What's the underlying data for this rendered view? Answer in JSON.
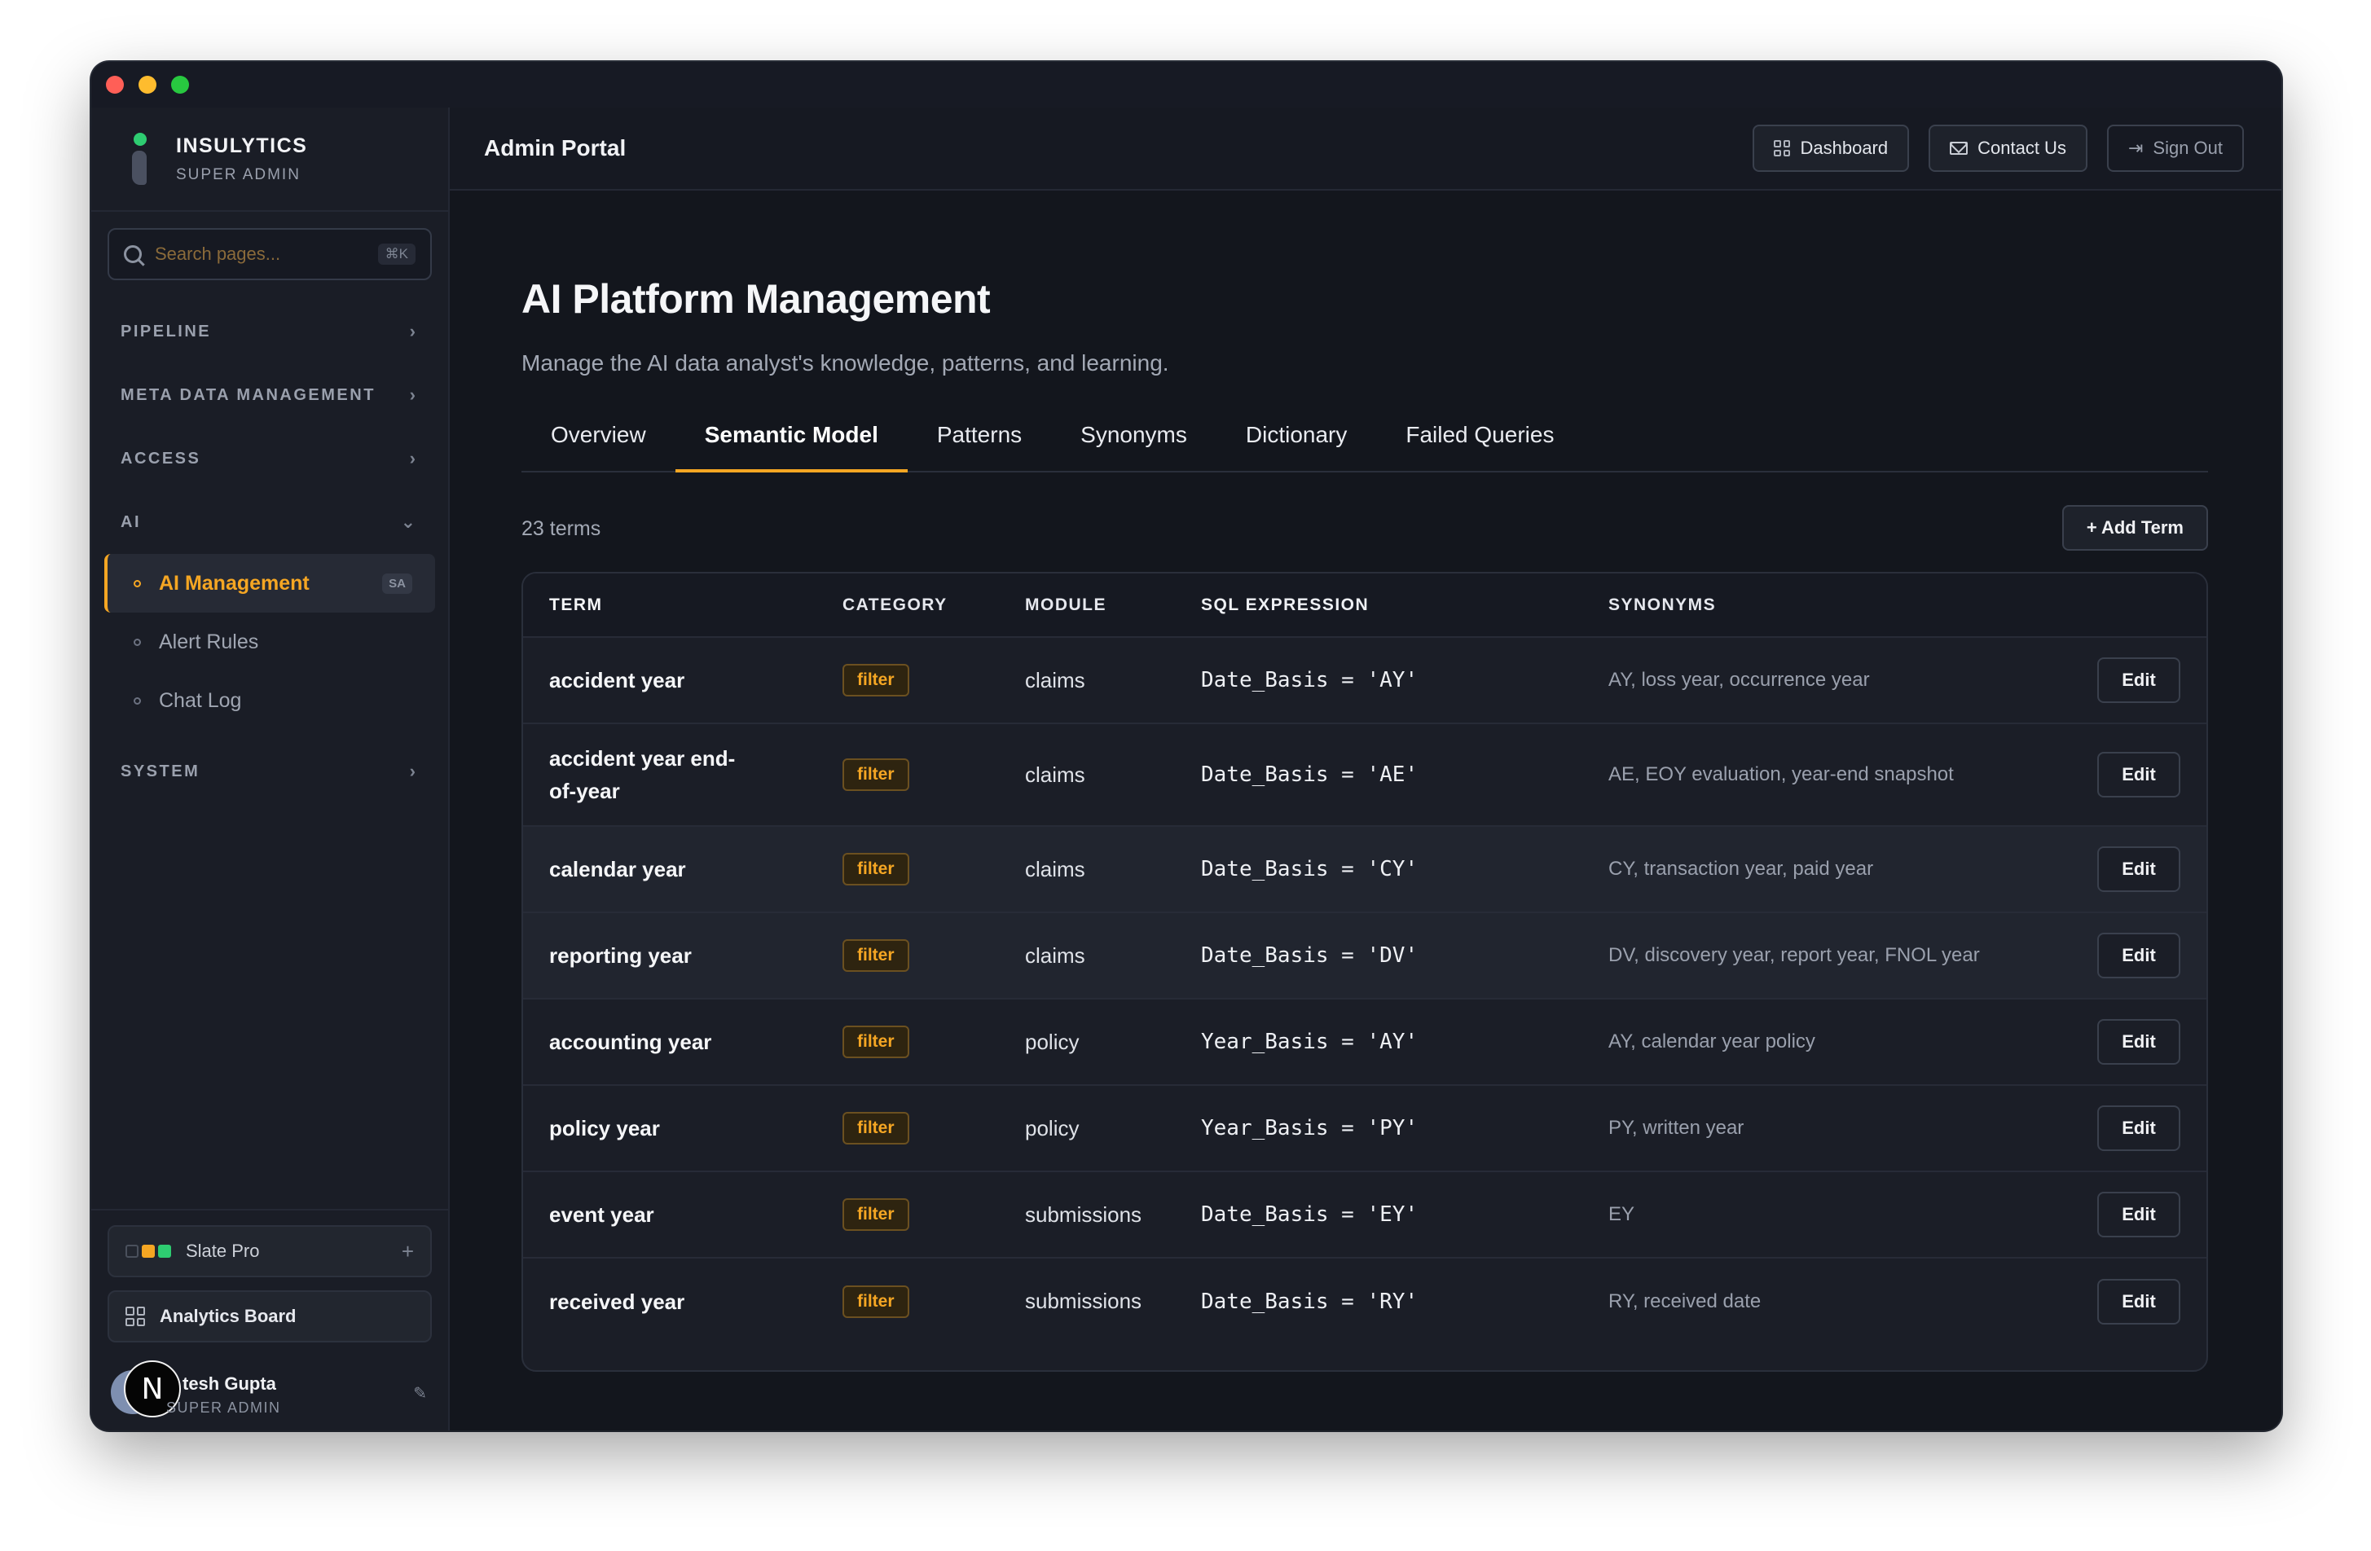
{
  "brand": {
    "name": "INSULYTICS",
    "role": "SUPER ADMIN"
  },
  "search": {
    "placeholder": "Search pages...",
    "shortcut": "⌘K"
  },
  "sidebar": {
    "sections": [
      {
        "label": "PIPELINE"
      },
      {
        "label": "META DATA MANAGEMENT"
      },
      {
        "label": "ACCESS"
      },
      {
        "label": "AI"
      },
      {
        "label": "SYSTEM"
      }
    ],
    "ai_items": [
      {
        "label": "AI Management",
        "badge": "SA"
      },
      {
        "label": "Alert Rules"
      },
      {
        "label": "Chat Log"
      }
    ],
    "workspace": "Slate Pro",
    "board": "Analytics Board"
  },
  "user": {
    "name": "tesh Gupta",
    "role": "SUPER ADMIN",
    "avatar_letter": "N"
  },
  "topbar": {
    "title": "Admin Portal",
    "dashboard": "Dashboard",
    "contact": "Contact Us",
    "signout": "Sign Out"
  },
  "page": {
    "title": "AI Platform Management",
    "subtitle": "Manage the AI data analyst's knowledge, patterns, and learning.",
    "tabs": [
      "Overview",
      "Semantic Model",
      "Patterns",
      "Synonyms",
      "Dictionary",
      "Failed Queries"
    ],
    "count": "23 terms",
    "add_label": "+ Add Term"
  },
  "table": {
    "headers": [
      "TERM",
      "CATEGORY",
      "MODULE",
      "SQL EXPRESSION",
      "SYNONYMS"
    ],
    "edit_label": "Edit",
    "rows": [
      {
        "term": "accident year",
        "category": "filter",
        "module": "claims",
        "sql": "Date_Basis = 'AY'",
        "synonyms": "AY, loss year, occurrence year"
      },
      {
        "term": "accident year end-of-year",
        "category": "filter",
        "module": "claims",
        "sql": "Date_Basis = 'AE'",
        "synonyms": "AE, EOY evaluation, year-end snapshot"
      },
      {
        "term": "calendar year",
        "category": "filter",
        "module": "claims",
        "sql": "Date_Basis = 'CY'",
        "synonyms": "CY, transaction year, paid year"
      },
      {
        "term": "reporting year",
        "category": "filter",
        "module": "claims",
        "sql": "Date_Basis = 'DV'",
        "synonyms": "DV, discovery year, report year, FNOL year"
      },
      {
        "term": "accounting year",
        "category": "filter",
        "module": "policy",
        "sql": "Year_Basis = 'AY'",
        "synonyms": "AY, calendar year policy"
      },
      {
        "term": "policy year",
        "category": "filter",
        "module": "policy",
        "sql": "Year_Basis = 'PY'",
        "synonyms": "PY, written year"
      },
      {
        "term": "event year",
        "category": "filter",
        "module": "submissions",
        "sql": "Date_Basis = 'EY'",
        "synonyms": "EY"
      },
      {
        "term": "received year",
        "category": "filter",
        "module": "submissions",
        "sql": "Date_Basis = 'RY'",
        "synonyms": "RY, received date"
      }
    ]
  },
  "colors": {
    "accent": "#f5a623",
    "bg": "#13161d",
    "sidebar": "#1a1d26"
  }
}
